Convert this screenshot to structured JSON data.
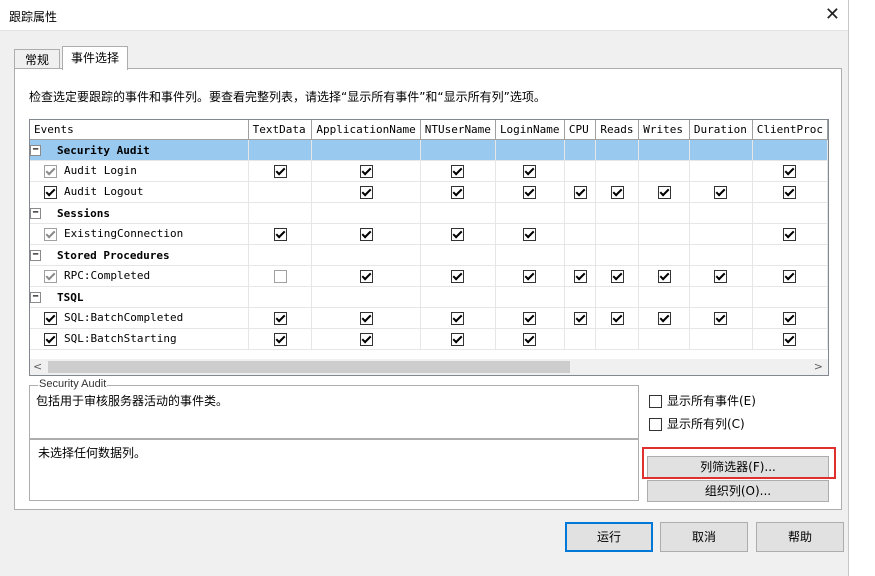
{
  "window": {
    "title": "跟踪属性",
    "close_glyph": "✕"
  },
  "tabs": [
    {
      "label": "常规"
    },
    {
      "label": "事件选择"
    }
  ],
  "hint": "检查选定要跟踪的事件和事件列。要查看完整列表，请选择“显示所有事件”和“显示所有列”选项。",
  "grid": {
    "columns": [
      "Events",
      "TextData",
      "ApplicationName",
      "NTUserName",
      "LoginName",
      "CPU",
      "Reads",
      "Writes",
      "Duration",
      "ClientProc"
    ],
    "rows": [
      {
        "type": "category",
        "label": "Security Audit",
        "selected": true
      },
      {
        "type": "event",
        "label": "Audit Login",
        "enabled": false,
        "checked": true,
        "cells": [
          1,
          1,
          1,
          1,
          0,
          0,
          0,
          0,
          1
        ]
      },
      {
        "type": "event",
        "label": "Audit Logout",
        "enabled": true,
        "checked": true,
        "cells": [
          0,
          1,
          1,
          1,
          1,
          1,
          1,
          1,
          1
        ]
      },
      {
        "type": "category",
        "label": "Sessions",
        "selected": false
      },
      {
        "type": "event",
        "label": "ExistingConnection",
        "enabled": false,
        "checked": true,
        "cells": [
          1,
          1,
          1,
          1,
          0,
          0,
          0,
          0,
          1
        ]
      },
      {
        "type": "category",
        "label": "Stored Procedures",
        "selected": false
      },
      {
        "type": "event",
        "label": "RPC:Completed",
        "enabled": false,
        "checked": true,
        "cells": [
          2,
          1,
          1,
          1,
          1,
          1,
          1,
          1,
          1
        ]
      },
      {
        "type": "category",
        "label": "TSQL",
        "selected": false
      },
      {
        "type": "event",
        "label": "SQL:BatchCompleted",
        "enabled": true,
        "checked": true,
        "cells": [
          1,
          1,
          1,
          1,
          1,
          1,
          1,
          1,
          1
        ]
      },
      {
        "type": "event",
        "label": "SQL:BatchStarting",
        "enabled": true,
        "checked": true,
        "cells": [
          1,
          1,
          1,
          1,
          0,
          0,
          0,
          0,
          1
        ]
      }
    ],
    "expander_glyph": "−"
  },
  "scroll": {
    "left_glyph": "<",
    "right_glyph": ">"
  },
  "description": {
    "legend": "Security Audit",
    "text": "包括用于审核服务器活动的事件类。"
  },
  "columns_info": {
    "text": "未选择任何数据列。"
  },
  "options": {
    "show_all_events": "显示所有事件(E)",
    "show_all_columns": "显示所有列(C)"
  },
  "buttons": {
    "column_filters": "列筛选器(F)...",
    "organize_columns": "组织列(O)...",
    "run": "运行",
    "cancel": "取消",
    "help": "帮助"
  }
}
